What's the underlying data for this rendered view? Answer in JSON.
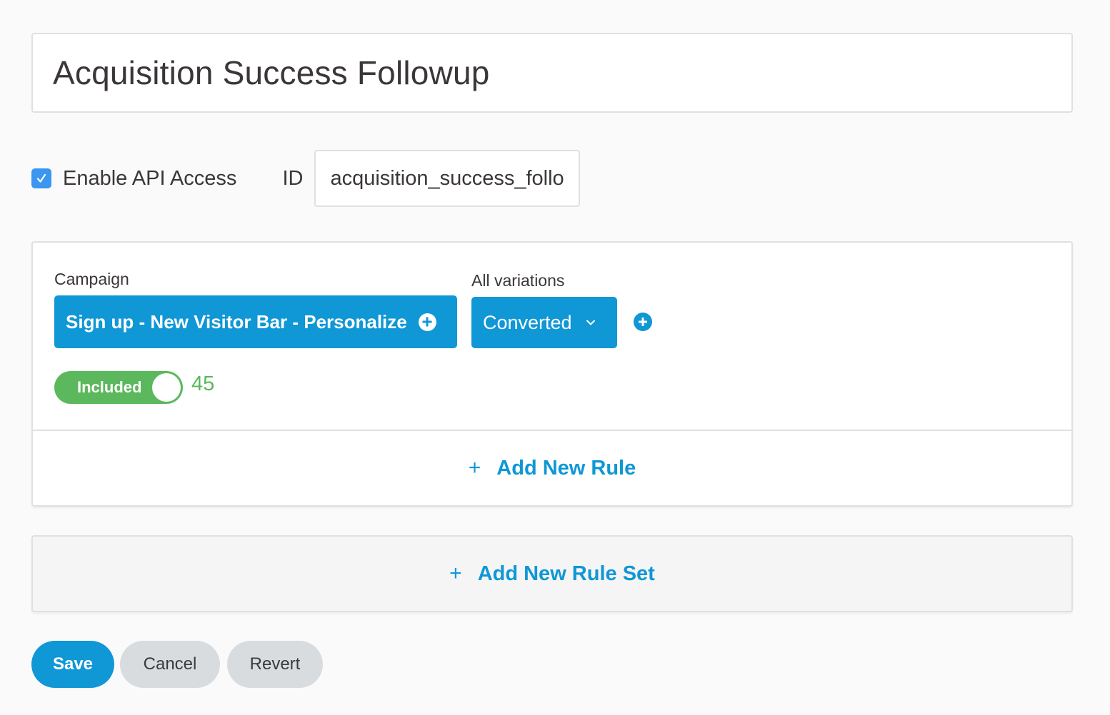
{
  "segment": {
    "title": "Acquisition Success Followup"
  },
  "api": {
    "enable_label": "Enable API Access",
    "enabled": true,
    "id_label": "ID",
    "id_value": "acquisition_success_followup"
  },
  "ruleset": {
    "rule": {
      "campaign_label": "Campaign",
      "campaign_value": "Sign up - New Visitor Bar - Personalize",
      "variation_label": "All variations",
      "variation_value": "Converted",
      "toggle_label": "Included",
      "toggle_on": true,
      "count": "45"
    },
    "add_rule_plus": "+",
    "add_rule_label": "Add New Rule"
  },
  "add_ruleset": {
    "plus": "+",
    "label": "Add New Rule Set"
  },
  "actions": {
    "save_label": "Save",
    "cancel_label": "Cancel",
    "revert_label": "Revert"
  },
  "colors": {
    "primary": "#0f97d6",
    "success": "#5cb85c",
    "checkbox": "#3a96f0",
    "secondary_button": "#d9dcde"
  }
}
